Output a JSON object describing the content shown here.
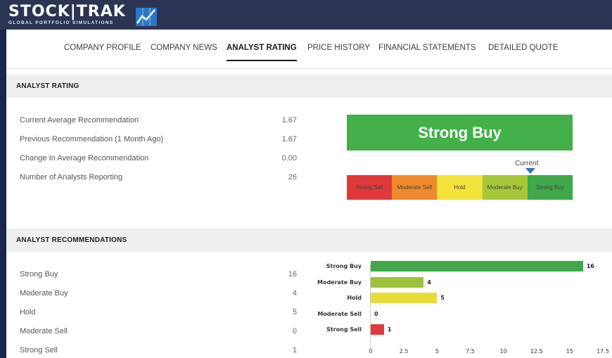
{
  "brand": {
    "name": "STOCK|TRAK",
    "tagline": "GLOBAL PORTFOLIO SIMULATIONS"
  },
  "tabs": [
    {
      "label": "COMPANY PROFILE"
    },
    {
      "label": "COMPANY NEWS"
    },
    {
      "label": "ANALYST RATING"
    },
    {
      "label": "PRICE HISTORY"
    },
    {
      "label": "FINANCIAL STATEMENTS"
    },
    {
      "label": "DETAILED QUOTE"
    }
  ],
  "active_tab": "ANALYST RATING",
  "rating": {
    "title": "ANALYST RATING",
    "rows": [
      {
        "label": "Current Average Recommendation",
        "value": "1.67"
      },
      {
        "label": "Previous Recommendation (1 Month Ago)",
        "value": "1.67"
      },
      {
        "label": "Change In Average Recommendation",
        "value": "0.00"
      },
      {
        "label": "Number of Analysts Reporting",
        "value": "26"
      }
    ],
    "verdict": "Strong Buy",
    "current_label": "Current",
    "scale": [
      {
        "label": "Strong Sell",
        "color": "#e0393c"
      },
      {
        "label": "Moderate Sell",
        "color": "#f08a2e"
      },
      {
        "label": "Hold",
        "color": "#f3e23b"
      },
      {
        "label": "Moderate Buy",
        "color": "#a5c83a"
      },
      {
        "label": "Strong Buy",
        "color": "#3ea84a"
      }
    ],
    "colors": {
      "verdict": "#44b04a",
      "marker": "#2f6fc4"
    }
  },
  "recommendations": {
    "title": "ANALYST RECOMMENDATIONS",
    "rows": [
      {
        "label": "Strong Buy",
        "value": "16"
      },
      {
        "label": "Moderate Buy",
        "value": "4"
      },
      {
        "label": "Hold",
        "value": "5"
      },
      {
        "label": "Moderate Sell",
        "value": "0"
      },
      {
        "label": "Strong Sell",
        "value": "1"
      }
    ]
  },
  "chart_data": {
    "type": "bar",
    "orientation": "horizontal",
    "categories": [
      "Strong Buy",
      "Moderate Buy",
      "Hold",
      "Moderate Sell",
      "Strong Sell"
    ],
    "values": [
      16,
      4,
      5,
      0,
      1
    ],
    "value_labels": [
      "16",
      "4",
      "5",
      "0",
      "1"
    ],
    "colors": [
      "#3ea84a",
      "#9cc13a",
      "#e8dc3a",
      "#cccccc",
      "#e0393c"
    ],
    "xlim": [
      0,
      17.5
    ],
    "xticks": [
      0,
      2.5,
      5,
      7.5,
      10,
      12.5,
      15,
      17.5
    ],
    "xtick_labels": [
      "0",
      "2.5",
      "5",
      "7.5",
      "10",
      "12.5",
      "15",
      "17.5"
    ],
    "grid": false,
    "legend": "none"
  }
}
